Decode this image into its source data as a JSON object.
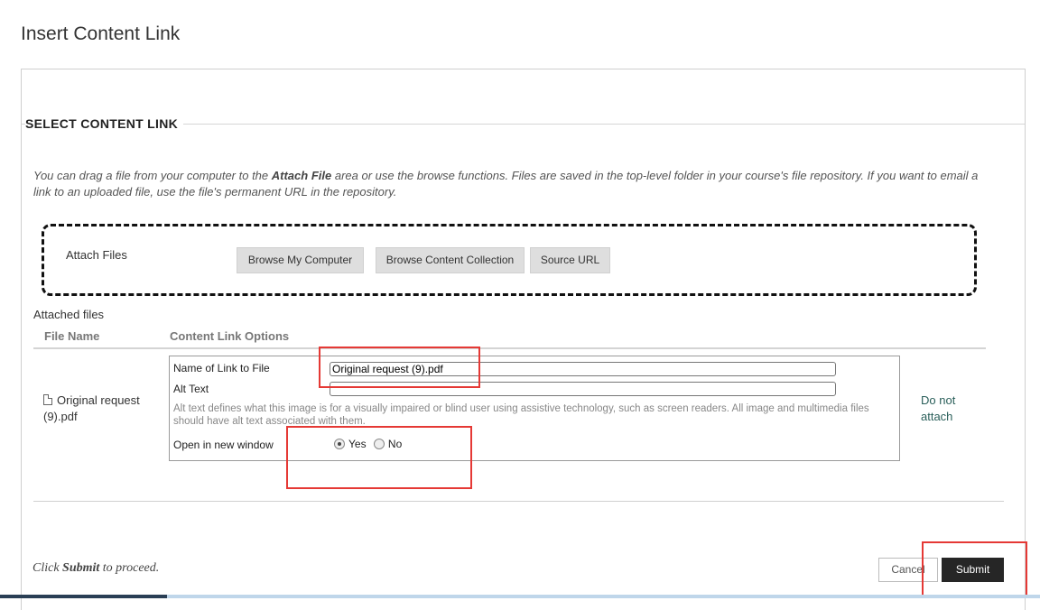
{
  "page": {
    "title": "Insert Content Link"
  },
  "section": {
    "heading": "SELECT CONTENT LINK",
    "intro_before": "You can drag a file from your computer to the ",
    "intro_bold": "Attach File",
    "intro_after": " area or use the browse functions. Files are saved in the top-level folder in your course's file repository. If you want to email a link to an uploaded file, use the file's permanent URL in the repository."
  },
  "attach": {
    "label": "Attach Files",
    "buttons": [
      "Browse My Computer",
      "Browse Content Collection",
      "Source URL"
    ]
  },
  "attached_files": {
    "label": "Attached files",
    "columns": [
      "File Name",
      "Content Link Options"
    ],
    "file_name": "Original request (9).pdf",
    "file_name_line1": "Original request",
    "file_name_line2": "(9).pdf",
    "remove_link": "Do not attach",
    "remove_line1": "Do not",
    "remove_line2": "attach"
  },
  "options": {
    "name_label": "Name of Link to File",
    "name_value": "Original request (9).pdf",
    "alt_label": "Alt Text",
    "alt_value": "",
    "alt_help": "Alt text defines what this image is for a visually impaired or blind user using assistive technology, such as screen readers. All image and multimedia files should have alt text associated with them.",
    "new_window_label": "Open in new window",
    "new_window_options": [
      "Yes",
      "No"
    ],
    "new_window_selected": "Yes"
  },
  "footer": {
    "proceed_before": "Click ",
    "proceed_bold": "Submit",
    "proceed_after": " to proceed.",
    "cancel": "Cancel",
    "submit": "Submit"
  },
  "colors": {
    "highlight": "#e53935",
    "submit_bg": "#262626",
    "link": "#2a5f5a"
  }
}
